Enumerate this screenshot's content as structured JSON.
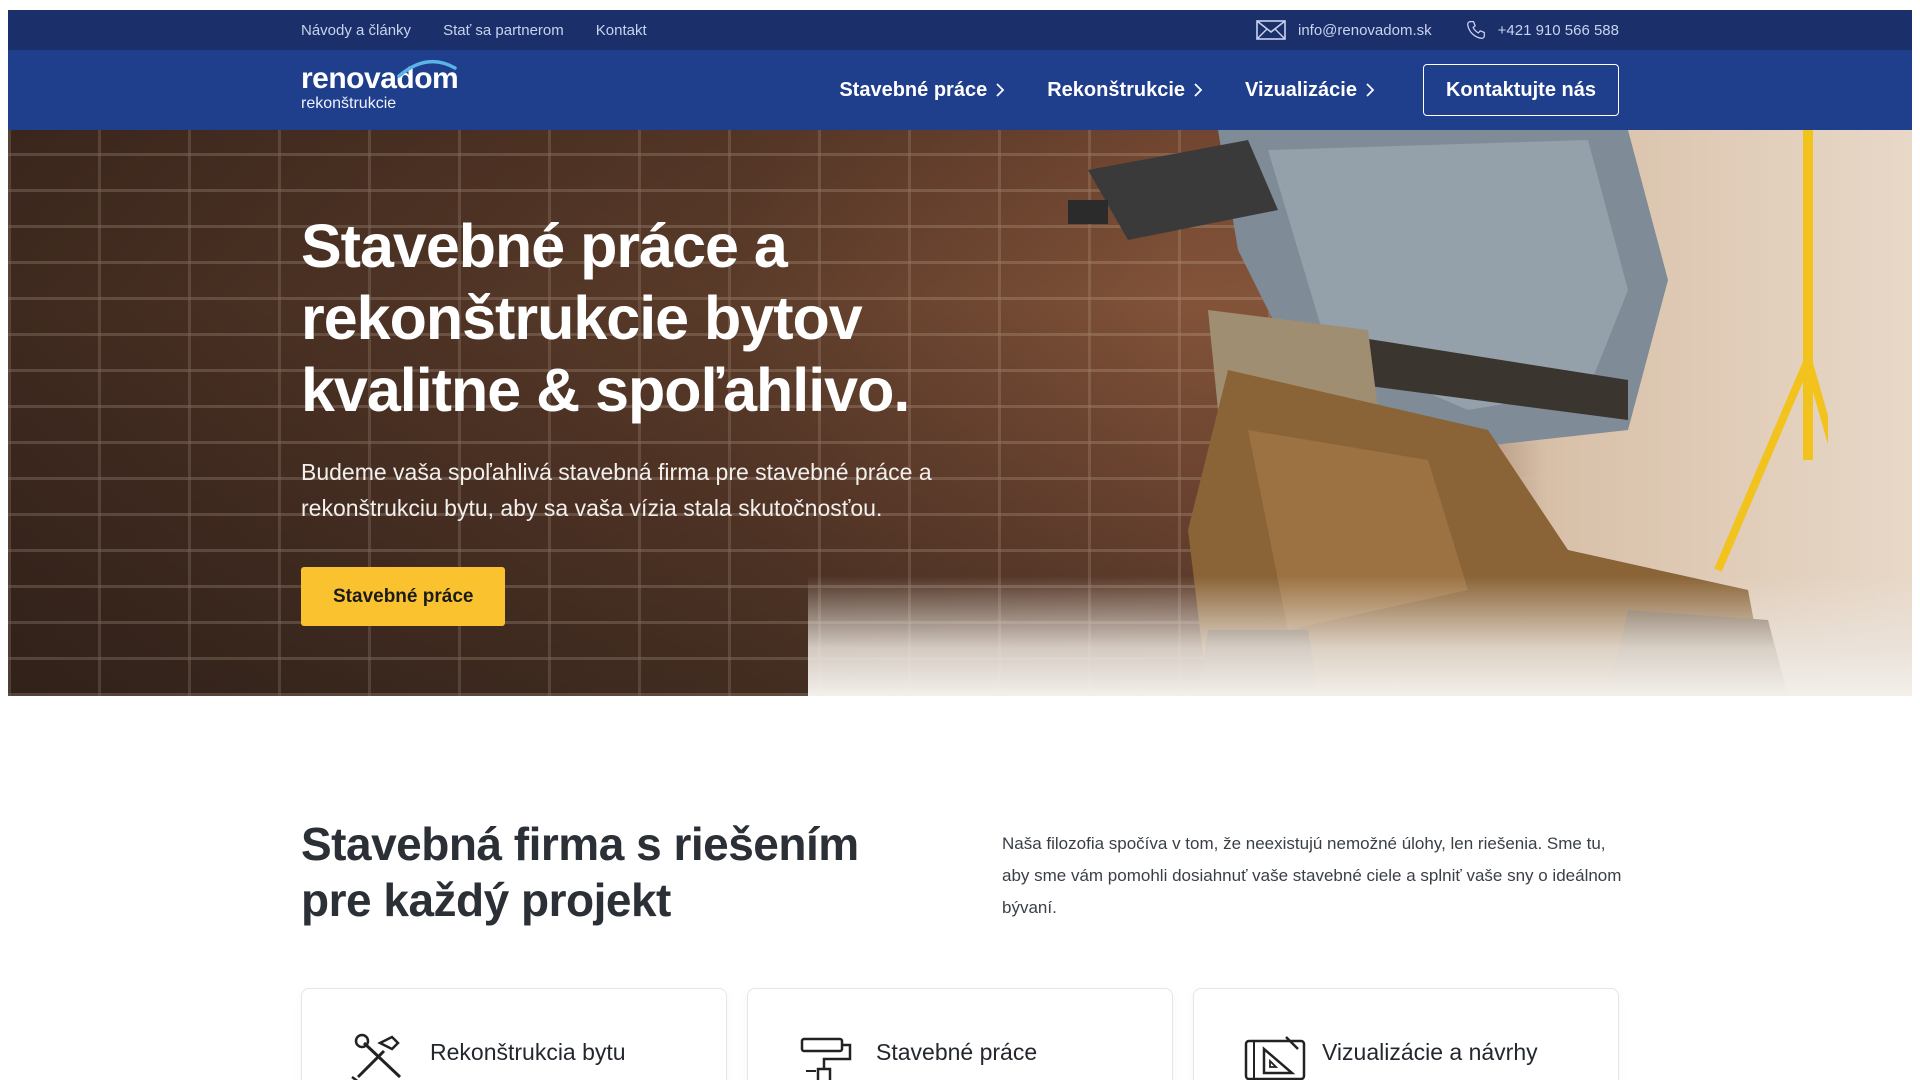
{
  "topbar": {
    "links": [
      "Návody a články",
      "Stať sa partnerom",
      "Kontakt"
    ],
    "email": "info@renovadom.sk",
    "phone": "+421 910 566 588"
  },
  "logo": {
    "name": "renovadom",
    "sub": "rekonštrukcie"
  },
  "nav": {
    "items": [
      "Stavebné práce",
      "Rekonštrukcie",
      "Vizualizácie"
    ],
    "cta": "Kontaktujte nás"
  },
  "hero": {
    "title": "Stavebné práce a rekonštrukcie bytov kvalitne & spoľahlivo.",
    "text": "Budeme vaša spoľahlivá stavebná firma pre stavebné práce a rekonštrukciu bytu, aby sa vaša vízia stala skutočnosťou.",
    "button": "Stavebné práce"
  },
  "section": {
    "title": "Stavebná firma s riešením pre každý projekt",
    "text": "Naša filozofia spočíva v tom, že neexistujú nemožné úlohy, len riešenia. Sme tu, aby sme vám pomohli dosiahnuť vaše stavebné ciele a splniť vaše sny o ideálnom bývaní."
  },
  "cards": [
    {
      "title": "Rekonštrukcia bytu",
      "icon": "tools-icon"
    },
    {
      "title": "Stavebné práce",
      "icon": "paint-roller-icon"
    },
    {
      "title": "Vizualizácie a návrhy",
      "icon": "blueprint-icon"
    }
  ],
  "colors": {
    "topbar": "#1b2f6b",
    "navbar": "#1f3e8c",
    "accent": "#f9c22e"
  }
}
